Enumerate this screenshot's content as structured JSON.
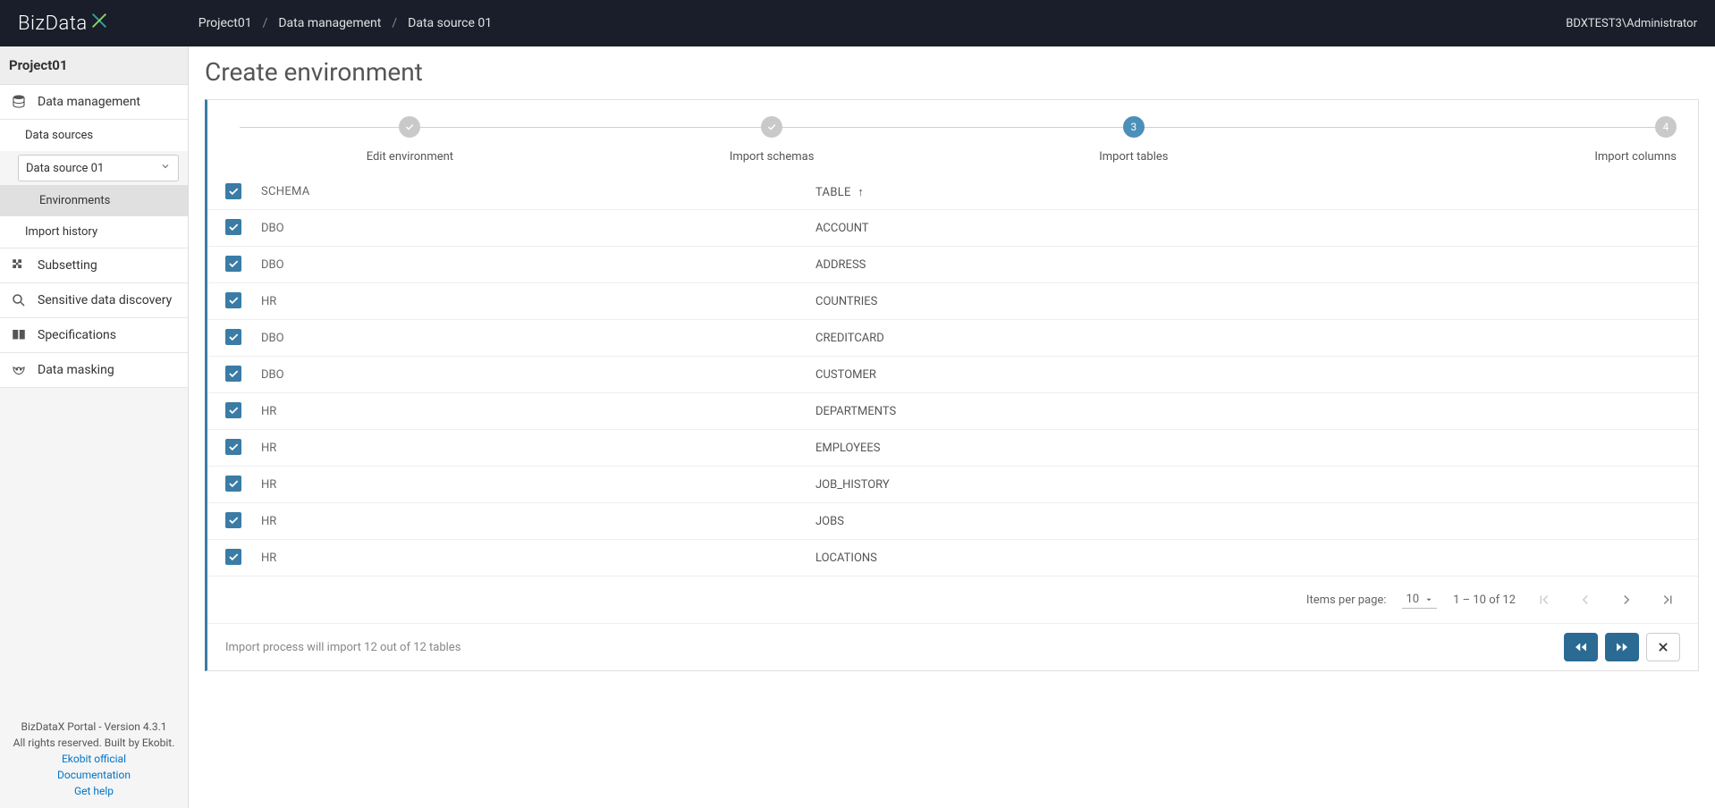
{
  "brand": {
    "name": "BizData",
    "suffix": "X"
  },
  "breadcrumb": [
    "Project01",
    "Data management",
    "Data source 01"
  ],
  "user": "BDXTEST3\\Administrator",
  "sidebar": {
    "project": "Project01",
    "items": [
      {
        "label": "Data management",
        "icon": "database"
      },
      {
        "label": "Data sources",
        "sub": true
      },
      {
        "label": "Environments",
        "subsub": true,
        "active": true
      },
      {
        "label": "Import history",
        "sub": true
      },
      {
        "label": "Subsetting",
        "icon": "puzzle"
      },
      {
        "label": "Sensitive data discovery",
        "icon": "search"
      },
      {
        "label": "Specifications",
        "icon": "book"
      },
      {
        "label": "Data masking",
        "icon": "mask"
      }
    ],
    "datasource_selected": "Data source 01",
    "footer": {
      "line1": "BizDataX Portal - Version 4.3.1",
      "line2": "All rights reserved. Built by Ekobit.",
      "links": [
        "Ekobit official",
        "Documentation",
        "Get help"
      ]
    }
  },
  "page": {
    "title": "Create environment",
    "steps": [
      {
        "label": "Edit environment",
        "state": "done"
      },
      {
        "label": "Import schemas",
        "state": "done"
      },
      {
        "label": "Import tables",
        "state": "active",
        "num": "3"
      },
      {
        "label": "Import columns",
        "state": "pending",
        "num": "4"
      }
    ],
    "columns": {
      "schema": "SCHEMA",
      "table": "TABLE"
    },
    "rows": [
      {
        "schema": "DBO",
        "table": "ACCOUNT"
      },
      {
        "schema": "DBO",
        "table": "ADDRESS"
      },
      {
        "schema": "HR",
        "table": "COUNTRIES"
      },
      {
        "schema": "DBO",
        "table": "CREDITCARD"
      },
      {
        "schema": "DBO",
        "table": "CUSTOMER"
      },
      {
        "schema": "HR",
        "table": "DEPARTMENTS"
      },
      {
        "schema": "HR",
        "table": "EMPLOYEES"
      },
      {
        "schema": "HR",
        "table": "JOB_HISTORY"
      },
      {
        "schema": "HR",
        "table": "JOBS"
      },
      {
        "schema": "HR",
        "table": "LOCATIONS"
      }
    ],
    "paginator": {
      "items_per_page_label": "Items per page:",
      "page_size": "10",
      "range": "1 – 10 of 12"
    },
    "footer_msg": "Import process will import 12 out of 12 tables"
  }
}
